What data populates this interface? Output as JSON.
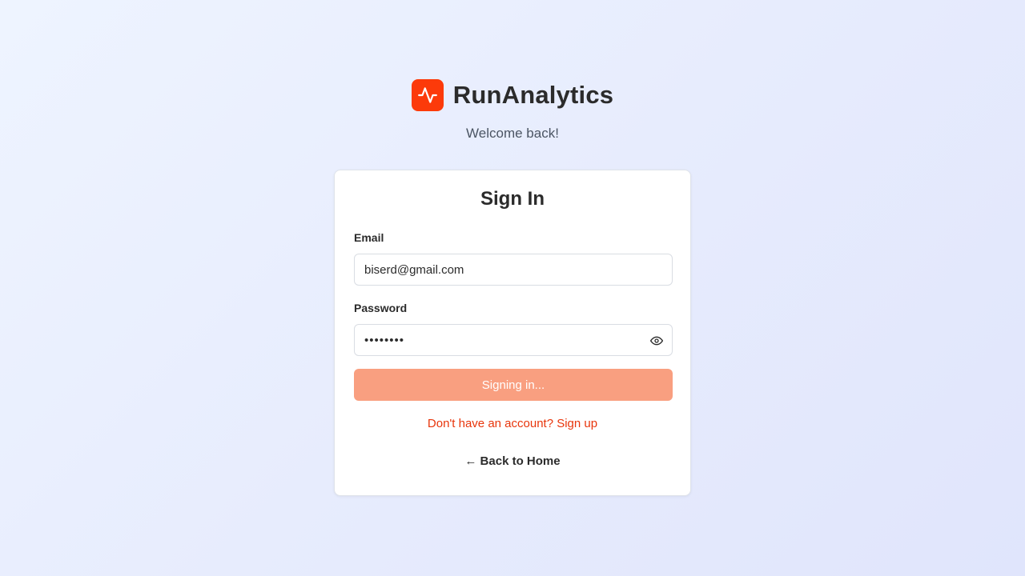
{
  "brand": {
    "app_name": "RunAnalytics",
    "logo_icon": "activity-pulse-icon",
    "logo_color": "#fc3a0a"
  },
  "welcome_text": "Welcome back!",
  "form": {
    "title": "Sign In",
    "email": {
      "label": "Email",
      "value": "biserd@gmail.com"
    },
    "password": {
      "label": "Password",
      "masked_value": "••••••••",
      "toggle_icon": "eye-icon"
    },
    "submit_label": "Signing in...",
    "signup_link": "Don't have an account? Sign up",
    "back_link": "← Back to Home"
  },
  "colors": {
    "accent": "#fc3a0a",
    "button_disabled": "#f99f80",
    "link": "#e8350b"
  }
}
